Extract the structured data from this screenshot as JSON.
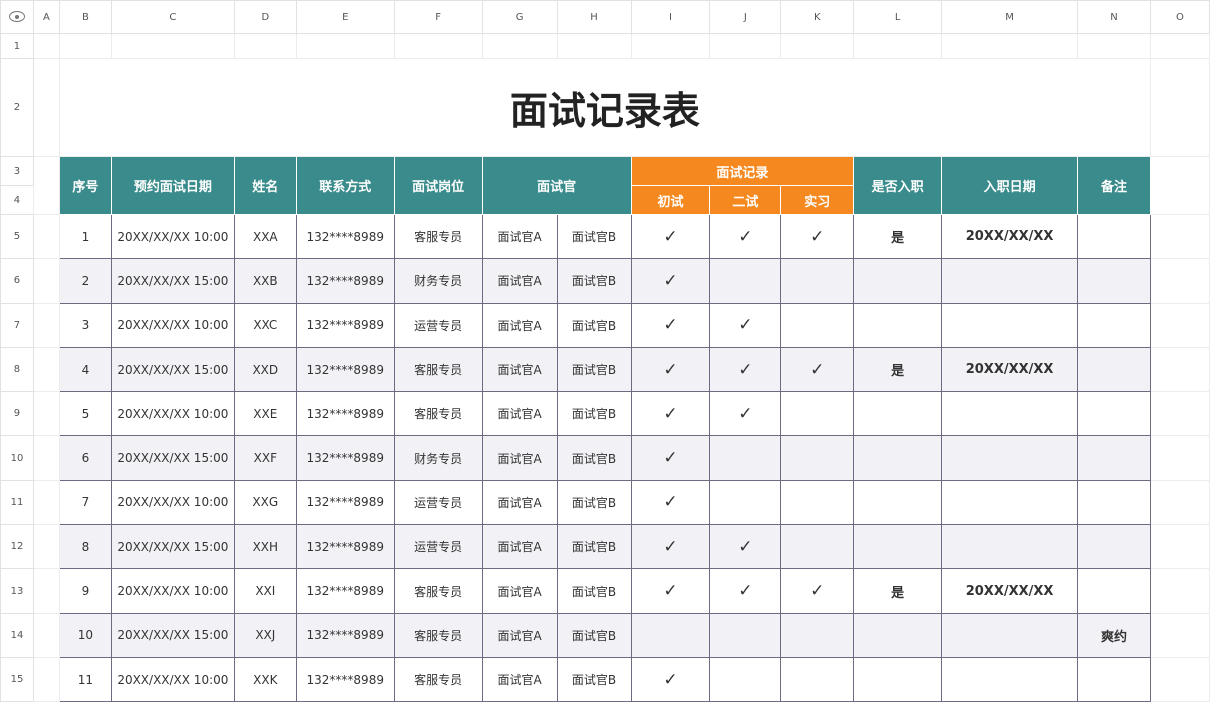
{
  "colheads": [
    "A",
    "B",
    "C",
    "D",
    "E",
    "F",
    "G",
    "H",
    "I",
    "J",
    "K",
    "L",
    "M",
    "N",
    "O"
  ],
  "rownums": [
    "1",
    "2",
    "3",
    "4",
    "5",
    "6",
    "7",
    "8",
    "9",
    "10",
    "11",
    "12",
    "13",
    "14",
    "15"
  ],
  "title": "面试记录表",
  "headers": {
    "seq": "序号",
    "date": "预约面试日期",
    "name": "姓名",
    "contact": "联系方式",
    "position": "面试岗位",
    "interviewer": "面试官",
    "record": "面试记录",
    "first": "初试",
    "second": "二试",
    "intern": "实习",
    "hired": "是否入职",
    "hire_date": "入职日期",
    "note": "备注"
  },
  "rows": [
    {
      "seq": "1",
      "date": "20XX/XX/XX 10:00",
      "name": "XXA",
      "contact": "132****8989",
      "position": "客服专员",
      "ia": "面试官A",
      "ib": "面试官B",
      "first": "✓",
      "second": "✓",
      "intern": "✓",
      "hired": "是",
      "hire_date": "20XX/XX/XX",
      "note": ""
    },
    {
      "seq": "2",
      "date": "20XX/XX/XX 15:00",
      "name": "XXB",
      "contact": "132****8989",
      "position": "财务专员",
      "ia": "面试官A",
      "ib": "面试官B",
      "first": "✓",
      "second": "",
      "intern": "",
      "hired": "",
      "hire_date": "",
      "note": ""
    },
    {
      "seq": "3",
      "date": "20XX/XX/XX 10:00",
      "name": "XXC",
      "contact": "132****8989",
      "position": "运营专员",
      "ia": "面试官A",
      "ib": "面试官B",
      "first": "✓",
      "second": "✓",
      "intern": "",
      "hired": "",
      "hire_date": "",
      "note": ""
    },
    {
      "seq": "4",
      "date": "20XX/XX/XX 15:00",
      "name": "XXD",
      "contact": "132****8989",
      "position": "客服专员",
      "ia": "面试官A",
      "ib": "面试官B",
      "first": "✓",
      "second": "✓",
      "intern": "✓",
      "hired": "是",
      "hire_date": "20XX/XX/XX",
      "note": ""
    },
    {
      "seq": "5",
      "date": "20XX/XX/XX 10:00",
      "name": "XXE",
      "contact": "132****8989",
      "position": "客服专员",
      "ia": "面试官A",
      "ib": "面试官B",
      "first": "✓",
      "second": "✓",
      "intern": "",
      "hired": "",
      "hire_date": "",
      "note": ""
    },
    {
      "seq": "6",
      "date": "20XX/XX/XX 15:00",
      "name": "XXF",
      "contact": "132****8989",
      "position": "财务专员",
      "ia": "面试官A",
      "ib": "面试官B",
      "first": "✓",
      "second": "",
      "intern": "",
      "hired": "",
      "hire_date": "",
      "note": ""
    },
    {
      "seq": "7",
      "date": "20XX/XX/XX 10:00",
      "name": "XXG",
      "contact": "132****8989",
      "position": "运营专员",
      "ia": "面试官A",
      "ib": "面试官B",
      "first": "✓",
      "second": "",
      "intern": "",
      "hired": "",
      "hire_date": "",
      "note": ""
    },
    {
      "seq": "8",
      "date": "20XX/XX/XX 15:00",
      "name": "XXH",
      "contact": "132****8989",
      "position": "运营专员",
      "ia": "面试官A",
      "ib": "面试官B",
      "first": "✓",
      "second": "✓",
      "intern": "",
      "hired": "",
      "hire_date": "",
      "note": ""
    },
    {
      "seq": "9",
      "date": "20XX/XX/XX 10:00",
      "name": "XXI",
      "contact": "132****8989",
      "position": "客服专员",
      "ia": "面试官A",
      "ib": "面试官B",
      "first": "✓",
      "second": "✓",
      "intern": "✓",
      "hired": "是",
      "hire_date": "20XX/XX/XX",
      "note": ""
    },
    {
      "seq": "10",
      "date": "20XX/XX/XX 15:00",
      "name": "XXJ",
      "contact": "132****8989",
      "position": "客服专员",
      "ia": "面试官A",
      "ib": "面试官B",
      "first": "",
      "second": "",
      "intern": "",
      "hired": "",
      "hire_date": "",
      "note": "爽约"
    },
    {
      "seq": "11",
      "date": "20XX/XX/XX 10:00",
      "name": "XXK",
      "contact": "132****8989",
      "position": "客服专员",
      "ia": "面试官A",
      "ib": "面试官B",
      "first": "✓",
      "second": "",
      "intern": "",
      "hired": "",
      "hire_date": "",
      "note": ""
    }
  ],
  "colors": {
    "teal": "#3a8b8b",
    "orange": "#f5891f",
    "shade": "#f2f2f6"
  },
  "icons": {
    "corner": "eye-icon"
  }
}
